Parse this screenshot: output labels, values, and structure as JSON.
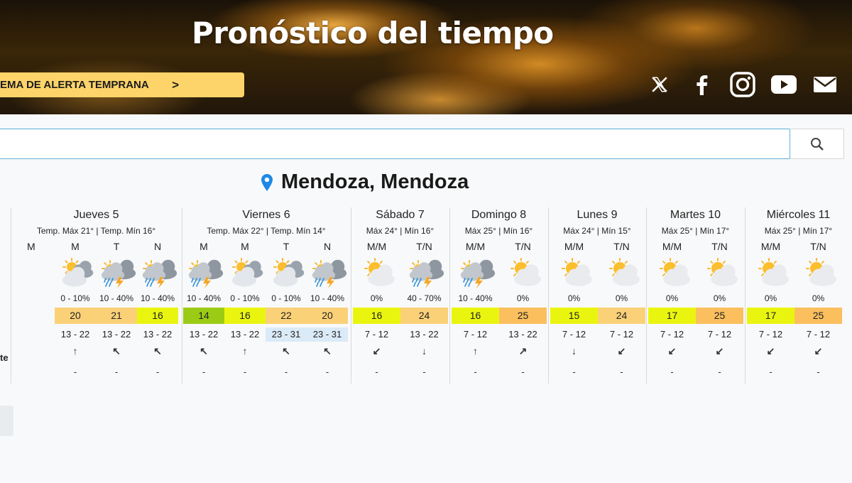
{
  "header": {
    "title": "Pronóstico del tiempo",
    "alert_button": "EMA DE ALERTA TEMPRANA",
    "alert_chevron": ">"
  },
  "social": [
    "x-icon",
    "facebook-icon",
    "instagram-icon",
    "youtube-icon",
    "mail-icon"
  ],
  "search": {
    "value": "",
    "button_icon": "search-icon"
  },
  "location": {
    "name": "Mendoza, Mendoza",
    "icon": "location-pin-icon",
    "pin_color": "#1e88e5"
  },
  "left_partial": {
    "subheader": "M",
    "row_label": "te"
  },
  "colors": {
    "lime": "#eaf50f",
    "green": "#9ccb16",
    "orange": "#fbd178",
    "light_orange": "#fbbf5e",
    "light_blue": "#dbeaf7"
  },
  "days": [
    {
      "title": "Jueves 5",
      "temps": "Temp. Máx 21° | Temp. Mín 16°",
      "slots": [
        {
          "label": "M",
          "icon": "cloudy-sun-icon",
          "prob": "0 - 10%",
          "temp": "20",
          "tcolor": "orange",
          "wind": "13 - 22",
          "wcolor": "",
          "dir": "↑",
          "dash": "-"
        },
        {
          "label": "T",
          "icon": "storm-icon",
          "prob": "10 - 40%",
          "temp": "21",
          "tcolor": "orange",
          "wind": "13 - 22",
          "wcolor": "",
          "dir": "↖",
          "dash": "-"
        },
        {
          "label": "N",
          "icon": "storm-icon",
          "prob": "10 - 40%",
          "temp": "16",
          "tcolor": "lime",
          "wind": "13 - 22",
          "wcolor": "",
          "dir": "↖",
          "dash": "-"
        }
      ]
    },
    {
      "title": "Viernes 6",
      "temps": "Temp. Máx 22° | Temp. Mín 14°",
      "slots": [
        {
          "label": "M",
          "icon": "storm-icon",
          "prob": "10 - 40%",
          "temp": "14",
          "tcolor": "green",
          "wind": "13 - 22",
          "wcolor": "",
          "dir": "↖",
          "dash": "-"
        },
        {
          "label": "M",
          "icon": "cloudy-sun-icon",
          "prob": "0 - 10%",
          "temp": "16",
          "tcolor": "lime",
          "wind": "13 - 22",
          "wcolor": "",
          "dir": "↑",
          "dash": "-"
        },
        {
          "label": "T",
          "icon": "cloudy-sun-icon",
          "prob": "0 - 10%",
          "temp": "22",
          "tcolor": "orange",
          "wind": "23 - 31",
          "wcolor": "light_blue",
          "dir": "↖",
          "dash": "-"
        },
        {
          "label": "N",
          "icon": "storm-icon",
          "prob": "10 - 40%",
          "temp": "20",
          "tcolor": "orange",
          "wind": "23 - 31",
          "wcolor": "light_blue",
          "dir": "↖",
          "dash": "-"
        }
      ]
    },
    {
      "title": "Sábado 7",
      "temps": "Máx 24° | Mín 16°",
      "slots": [
        {
          "label": "M/M",
          "icon": "partly-sunny-icon",
          "prob": "0%",
          "temp": "16",
          "tcolor": "lime",
          "wind": "7 - 12",
          "wcolor": "",
          "dir": "↙",
          "dash": "-"
        },
        {
          "label": "T/N",
          "icon": "storm-icon",
          "prob": "40 - 70%",
          "temp": "24",
          "tcolor": "orange",
          "wind": "13 - 22",
          "wcolor": "",
          "dir": "↓",
          "dash": "-"
        }
      ]
    },
    {
      "title": "Domingo 8",
      "temps": "Máx 25° | Mín 16°",
      "slots": [
        {
          "label": "M/M",
          "icon": "storm-icon",
          "prob": "10 - 40%",
          "temp": "16",
          "tcolor": "lime",
          "wind": "7 - 12",
          "wcolor": "",
          "dir": "↑",
          "dash": "-"
        },
        {
          "label": "T/N",
          "icon": "partly-sunny-icon",
          "prob": "0%",
          "temp": "25",
          "tcolor": "light_orange",
          "wind": "13 - 22",
          "wcolor": "",
          "dir": "↗",
          "dash": "-"
        }
      ]
    },
    {
      "title": "Lunes 9",
      "temps": "Máx 24° | Mín 15°",
      "slots": [
        {
          "label": "M/M",
          "icon": "partly-sunny-icon",
          "prob": "0%",
          "temp": "15",
          "tcolor": "lime",
          "wind": "7 - 12",
          "wcolor": "",
          "dir": "↓",
          "dash": "-"
        },
        {
          "label": "T/N",
          "icon": "partly-sunny-icon",
          "prob": "0%",
          "temp": "24",
          "tcolor": "orange",
          "wind": "7 - 12",
          "wcolor": "",
          "dir": "↙",
          "dash": "-"
        }
      ]
    },
    {
      "title": "Martes 10",
      "temps": "Máx 25° | Mín 17°",
      "slots": [
        {
          "label": "M/M",
          "icon": "partly-sunny-icon",
          "prob": "0%",
          "temp": "17",
          "tcolor": "lime",
          "wind": "7 - 12",
          "wcolor": "",
          "dir": "↙",
          "dash": "-"
        },
        {
          "label": "T/N",
          "icon": "partly-sunny-icon",
          "prob": "0%",
          "temp": "25",
          "tcolor": "light_orange",
          "wind": "7 - 12",
          "wcolor": "",
          "dir": "↙",
          "dash": "-"
        }
      ]
    },
    {
      "title": "Miércoles 11",
      "temps": "Máx 25° | Mín 17°",
      "slots": [
        {
          "label": "M/M",
          "icon": "partly-sunny-icon",
          "prob": "0%",
          "temp": "17",
          "tcolor": "lime",
          "wind": "7 - 12",
          "wcolor": "",
          "dir": "↙",
          "dash": "-"
        },
        {
          "label": "T/N",
          "icon": "partly-sunny-icon",
          "prob": "0%",
          "temp": "25",
          "tcolor": "light_orange",
          "wind": "7 - 12",
          "wcolor": "",
          "dir": "↙",
          "dash": "-"
        }
      ]
    }
  ]
}
